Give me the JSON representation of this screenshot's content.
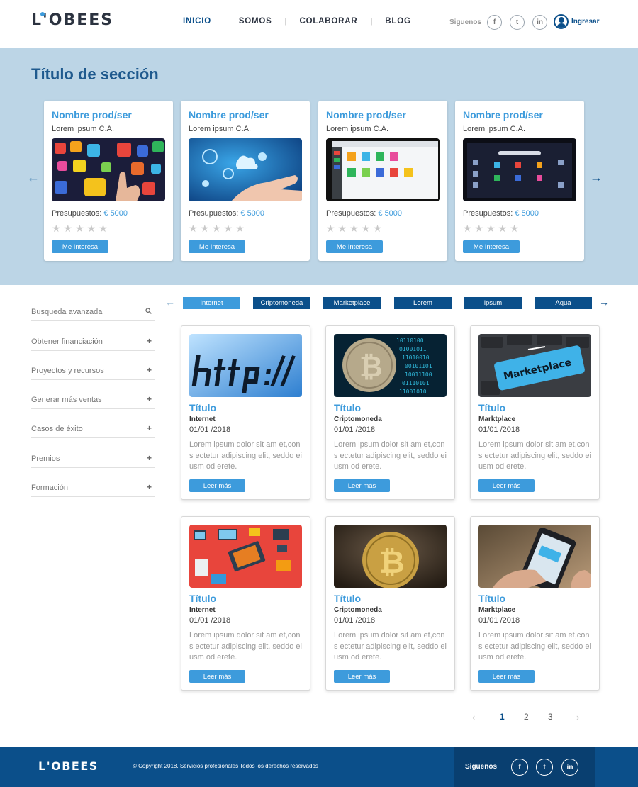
{
  "header": {
    "logo": "L'OBEES",
    "nav": [
      "INICIO",
      "SOMOS",
      "COLABORAR",
      "BLOG"
    ],
    "social_label": "Siguenos",
    "social": [
      "f",
      "t",
      "in"
    ],
    "login_label": "Ingresar"
  },
  "hero": {
    "title": "Título de sección",
    "products": [
      {
        "name": "Nombre prod/ser",
        "company": "Lorem ipsum C.A.",
        "budget_label": "Presupuestos:",
        "budget": "€ 5000",
        "stars": "★★★★★",
        "button": "Me Interesa",
        "image": "apps-icons-photo"
      },
      {
        "name": "Nombre prod/ser",
        "company": "Lorem ipsum C.A.",
        "budget_label": "Presupuestos:",
        "budget": "€ 5000",
        "stars": "★★★★★",
        "button": "Me Interesa",
        "image": "cloud-hand-photo"
      },
      {
        "name": "Nombre prod/ser",
        "company": "Lorem ipsum C.A.",
        "budget_label": "Presupuestos:",
        "budget": "€ 5000",
        "stars": "★★★★★",
        "button": "Me Interesa",
        "image": "app-store-screen-photo"
      },
      {
        "name": "Nombre prod/ser",
        "company": "Lorem ipsum C.A.",
        "budget_label": "Presupuestos:",
        "budget": "€ 5000",
        "stars": "★★★★★",
        "button": "Me Interesa",
        "image": "dark-desktop-screen-photo"
      }
    ]
  },
  "sidebar": {
    "items": [
      {
        "label": "Busqueda avanzada",
        "icon": "⚲"
      },
      {
        "label": "Obtener financiación",
        "icon": "+"
      },
      {
        "label": "Proyectos y recursos",
        "icon": "+"
      },
      {
        "label": "Generar más ventas",
        "icon": "+"
      },
      {
        "label": "Casos de éxito",
        "icon": "+"
      },
      {
        "label": "Premios",
        "icon": "+"
      },
      {
        "label": "Formación",
        "icon": "+"
      }
    ]
  },
  "tags": [
    "Internet",
    "Criptomoneda",
    "Marketplace",
    "Lorem",
    "ipsum",
    "Aqua"
  ],
  "articles": [
    {
      "title": "Título",
      "category": "Internet",
      "date": "01/01 /2018",
      "desc": "Lorem ipsum dolor sit am et,cons ectetur adipiscing elit, seddo eiusm od erete.",
      "button": "Leer más",
      "image": "http-screen-photo"
    },
    {
      "title": "Título",
      "category": "Criptomoneda",
      "date": "01/01 /2018",
      "desc": "Lorem ipsum dolor sit am et,cons ectetur adipiscing elit, seddo eiusm od erete.",
      "button": "Leer más",
      "image": "bitcoin-binary-photo"
    },
    {
      "title": "Título",
      "category": "Marktplace",
      "date": "01/01 /2018",
      "desc": "Lorem ipsum dolor sit am et,cons ectetur adipiscing elit, seddo eiusm od erete.",
      "button": "Leer más",
      "image": "marketplace-key-photo",
      "key_text": "Marketplace"
    },
    {
      "title": "Título",
      "category": "Internet",
      "date": "01/01 /2018",
      "desc": "Lorem ipsum dolor sit am et,cons ectetur adipiscing elit, seddo eiusm od erete.",
      "button": "Leer más",
      "image": "isometric-devices-illustration"
    },
    {
      "title": "Título",
      "category": "Criptomoneda",
      "date": "01/01 /2018",
      "desc": "Lorem ipsum dolor sit am et,cons ectetur adipiscing elit, seddo eiusm od erete.",
      "button": "Leer más",
      "image": "gold-bitcoin-photo"
    },
    {
      "title": "Título",
      "category": "Marktplace",
      "date": "01/01 /2018",
      "desc": "Lorem ipsum dolor sit am et,cons ectetur adipiscing elit, seddo eiusm od erete.",
      "button": "Leer más",
      "image": "phone-shopping-photo"
    }
  ],
  "pagination": {
    "prev": "‹",
    "pages": [
      "1",
      "2",
      "3"
    ],
    "current": "1",
    "next": "›"
  },
  "footer": {
    "logo": "L'OBEES",
    "copyright": "© Copyright 2018. Servicios profesionales Todos los derechos reservados",
    "social_label": "Siguenos",
    "social": [
      "f",
      "t",
      "in"
    ]
  },
  "colors": {
    "primary": "#0b4f8a",
    "accent": "#3d9bdc",
    "hero_bg": "#bcd5e6"
  }
}
